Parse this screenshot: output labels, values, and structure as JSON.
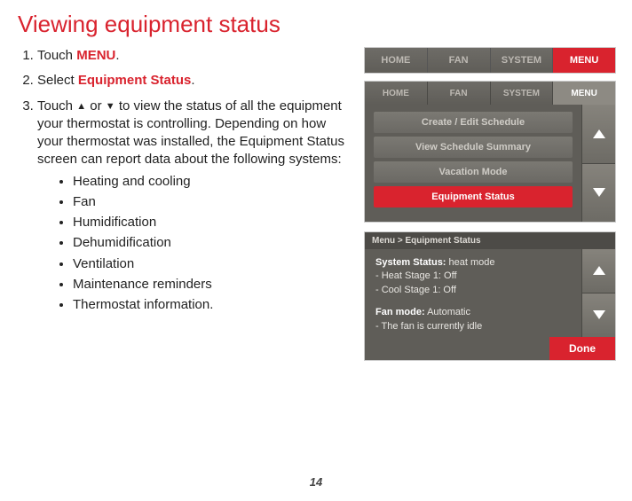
{
  "title": "Viewing equipment status",
  "steps": {
    "s1_pre": "Touch ",
    "s1_kw": "MENU",
    "s1_post": ".",
    "s2_pre": "Select ",
    "s2_kw": "Equipment Status",
    "s2_post": ".",
    "s3_pre": "Touch ",
    "s3_mid": " or ",
    "s3_post": " to view the status of all the equipment your thermostat is controlling. Depending on how your thermostat was installed, the Equipment Status screen can report data about the following systems:"
  },
  "bullets": [
    "Heating and cooling",
    "Fan",
    "Humidification",
    "Dehumidification",
    "Ventilation",
    "Maintenance reminders",
    "Thermostat information."
  ],
  "shot1": {
    "tabs": [
      "HOME",
      "FAN",
      "SYSTEM",
      "MENU"
    ]
  },
  "shot2": {
    "tabs": [
      "HOME",
      "FAN",
      "SYSTEM",
      "MENU"
    ],
    "items": [
      "Create / Edit Schedule",
      "View Schedule Summary",
      "Vacation Mode",
      "Equipment Status"
    ]
  },
  "shot3": {
    "crumb": "Menu > Equipment Status",
    "sysLabel": "System Status:",
    "sysVal": " heat mode",
    "heat": "- Heat Stage 1: Off",
    "cool": "- Cool Stage 1: Off",
    "fanLabel": "Fan mode:",
    "fanVal": " Automatic",
    "fanLine": "- The fan is currently idle",
    "done": "Done"
  },
  "pageNum": "14"
}
